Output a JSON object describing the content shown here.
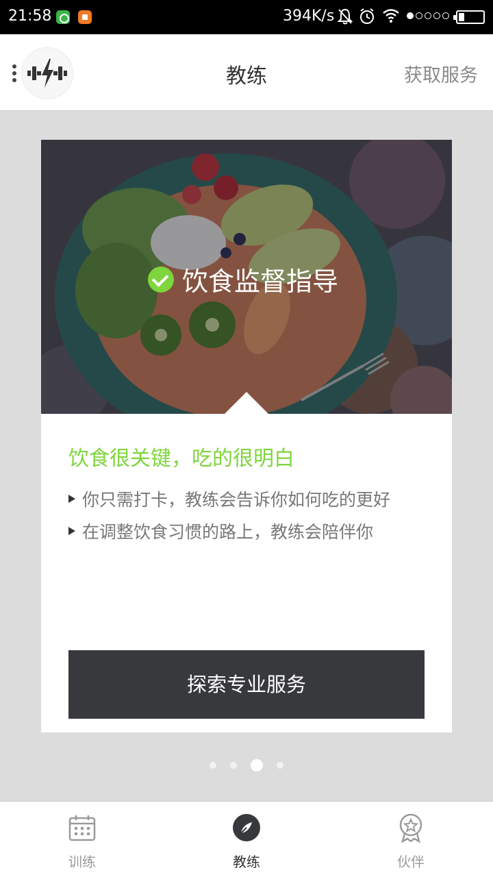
{
  "status_bar": {
    "time": "21:58",
    "network_speed": "394K/s",
    "icons": [
      "shield-app-icon",
      "orange-app-icon",
      "bell-muted-icon",
      "alarm-icon",
      "wifi-icon",
      "signal-dots-icon",
      "battery-icon"
    ],
    "signal_strength_dots": 1,
    "signal_total_dots": 5
  },
  "header": {
    "logo_icon": "dumbbell-bolt-logo",
    "menu_icon": "vertical-dots-icon",
    "title": "教练",
    "action": "获取服务"
  },
  "card": {
    "hero_title": "饮食监督指导",
    "hero_icon": "check-circle-icon",
    "heading": "饮食很关键，吃的很明白",
    "bullets": [
      "你只需打卡，教练会告诉你如何吃的更好",
      "在调整饮食习惯的路上，教练会陪伴你"
    ],
    "cta_label": "探索专业服务"
  },
  "pager": {
    "count": 4,
    "active_index": 2
  },
  "bottom_nav": {
    "items": [
      {
        "label": "训练",
        "icon": "calendar-icon",
        "active": false
      },
      {
        "label": "教练",
        "icon": "compass-leaf-icon",
        "active": true
      },
      {
        "label": "伙伴",
        "icon": "badge-star-icon",
        "active": false
      }
    ]
  },
  "colors": {
    "accent_green": "#7ed53d",
    "cta_dark": "#38393d",
    "background": "#dcdcdc"
  }
}
